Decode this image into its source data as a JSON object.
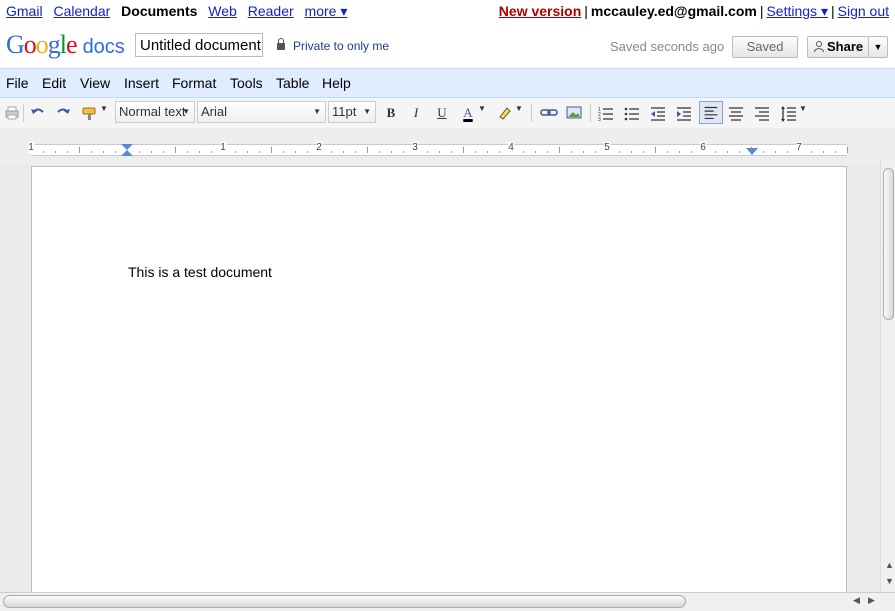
{
  "gbar": {
    "links": [
      "Gmail",
      "Calendar",
      "Documents",
      "Web",
      "Reader",
      "more ▾"
    ],
    "new_version": "New version",
    "email": "mccauley.ed@gmail.com",
    "settings": "Settings ▾",
    "sign_out": "Sign out",
    "separator": "|"
  },
  "header": {
    "logo_text": "Google",
    "logo_product": "docs",
    "doc_title": "Untitled document",
    "privacy": "Private to only me",
    "save_status": "Saved seconds ago",
    "saved_button": "Saved",
    "share_button": "Share",
    "share_dropdown": "▼"
  },
  "menu": [
    "File",
    "Edit",
    "View",
    "Insert",
    "Format",
    "Tools",
    "Table",
    "Help"
  ],
  "toolbar": {
    "style_select": "Normal text",
    "font_select": "Arial",
    "size_select": "11pt",
    "bold": "B",
    "italic": "I",
    "underline": "U",
    "text_color": "A",
    "text_color_value": "#000000",
    "align_pressed": "align-left",
    "icons": [
      "print-icon",
      "undo-icon",
      "redo-icon",
      "paint-format-icon",
      "text-color-icon",
      "highlight-icon",
      "link-icon",
      "image-icon",
      "numbered-list-icon",
      "bulleted-list-icon",
      "decrease-indent-icon",
      "increase-indent-icon",
      "align-left-icon",
      "align-center-icon",
      "align-right-icon",
      "line-spacing-icon"
    ]
  },
  "ruler": {
    "numbers": [
      "1",
      "1",
      "2",
      "3",
      "4",
      "5",
      "6",
      "7"
    ]
  },
  "document": {
    "body_text": "This is a test document"
  },
  "colors": {
    "link": "#1122cc",
    "new_version": "#aa0000",
    "menubar_bg": "#e0ecff",
    "accent_blue": "#3369e8"
  }
}
